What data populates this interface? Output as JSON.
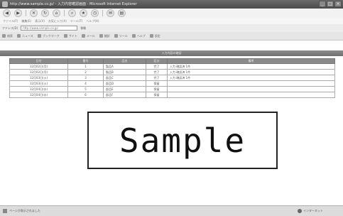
{
  "window": {
    "title": "http://www.sample.co.jp/ - 入力内容確認画面 - Microsoft Internet Explorer",
    "buttons": [
      "_",
      "□",
      "×"
    ]
  },
  "toolbar": {
    "back_glyph": "◀",
    "forward_glyph": "▶",
    "icons": [
      "stop-icon",
      "refresh-icon",
      "home-icon",
      "search-icon",
      "favorites-icon",
      "history-icon",
      "mail-icon",
      "print-icon"
    ]
  },
  "menubar": {
    "items": [
      "ファイル(F)",
      "編集(E)",
      "表示(V)",
      "お気に入り(A)",
      "ツール(T)",
      "ヘルプ(H)"
    ]
  },
  "address": {
    "label": "アドレス(D)",
    "value": "http://www.sample.co.jp/",
    "go": "移動"
  },
  "links": {
    "items": [
      "検索",
      "ニュース",
      "ブックマーク",
      "サイト",
      "メール",
      "翻訳",
      "ツール",
      "ヘルプ",
      "設定"
    ]
  },
  "page": {
    "header": "入力内容の確認"
  },
  "table": {
    "headers": [
      "日付",
      "番号",
      "品名",
      "区分",
      "備考"
    ],
    "rows": [
      [
        "12月02日(月)",
        "1",
        "製品A",
        "完了",
        "入力 確認済 1件"
      ],
      [
        "12月02日(月)",
        "2",
        "製品B",
        "完了",
        "入力 確認済 1件"
      ],
      [
        "12月03日(火)",
        "3",
        "部品C",
        "完了",
        "入力 確認済 1件"
      ],
      [
        "12月03日(火)",
        "4",
        "部品D",
        "保留",
        ""
      ],
      [
        "12月04日(水)",
        "5",
        "部品E",
        "保留",
        ""
      ],
      [
        "12月04日(水)",
        "6",
        "部品F",
        "保留",
        ""
      ]
    ]
  },
  "overlay": {
    "text": "Sample"
  },
  "status": {
    "left": "ページが表示されました",
    "right": "インターネット"
  }
}
